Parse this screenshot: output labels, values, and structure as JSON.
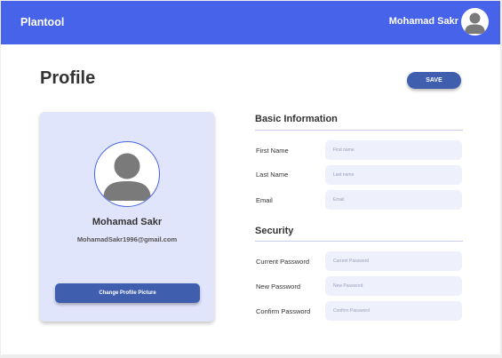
{
  "header": {
    "app_title": "Plantool",
    "user_name": "Mohamad Sakr",
    "avatar_icon": "user-avatar-icon"
  },
  "page": {
    "title": "Profile",
    "save_label": "SAVE"
  },
  "profile_card": {
    "name": "Mohamad Sakr",
    "email": "MohamadSakr1996@gmail.com",
    "change_picture_label": "Change Profile Picture",
    "avatar_icon": "user-avatar-icon"
  },
  "basic_info": {
    "heading": "Basic Information",
    "fields": [
      {
        "label": "First Name",
        "placeholder": "First name",
        "value": ""
      },
      {
        "label": "Last Name",
        "placeholder": "Last name",
        "value": ""
      },
      {
        "label": "Email",
        "placeholder": "Email",
        "value": ""
      }
    ]
  },
  "security": {
    "heading": "Security",
    "fields": [
      {
        "label": "Current Password",
        "placeholder": "Current Password",
        "value": ""
      },
      {
        "label": "New Password",
        "placeholder": "New Password",
        "value": ""
      },
      {
        "label": "Confirm Password",
        "placeholder": "Confirm Password",
        "value": ""
      }
    ]
  },
  "colors": {
    "header_bg": "#4763e9",
    "button_bg": "#3f5eae",
    "card_bg": "#e1e5fb",
    "input_bg": "#eef0fc"
  }
}
